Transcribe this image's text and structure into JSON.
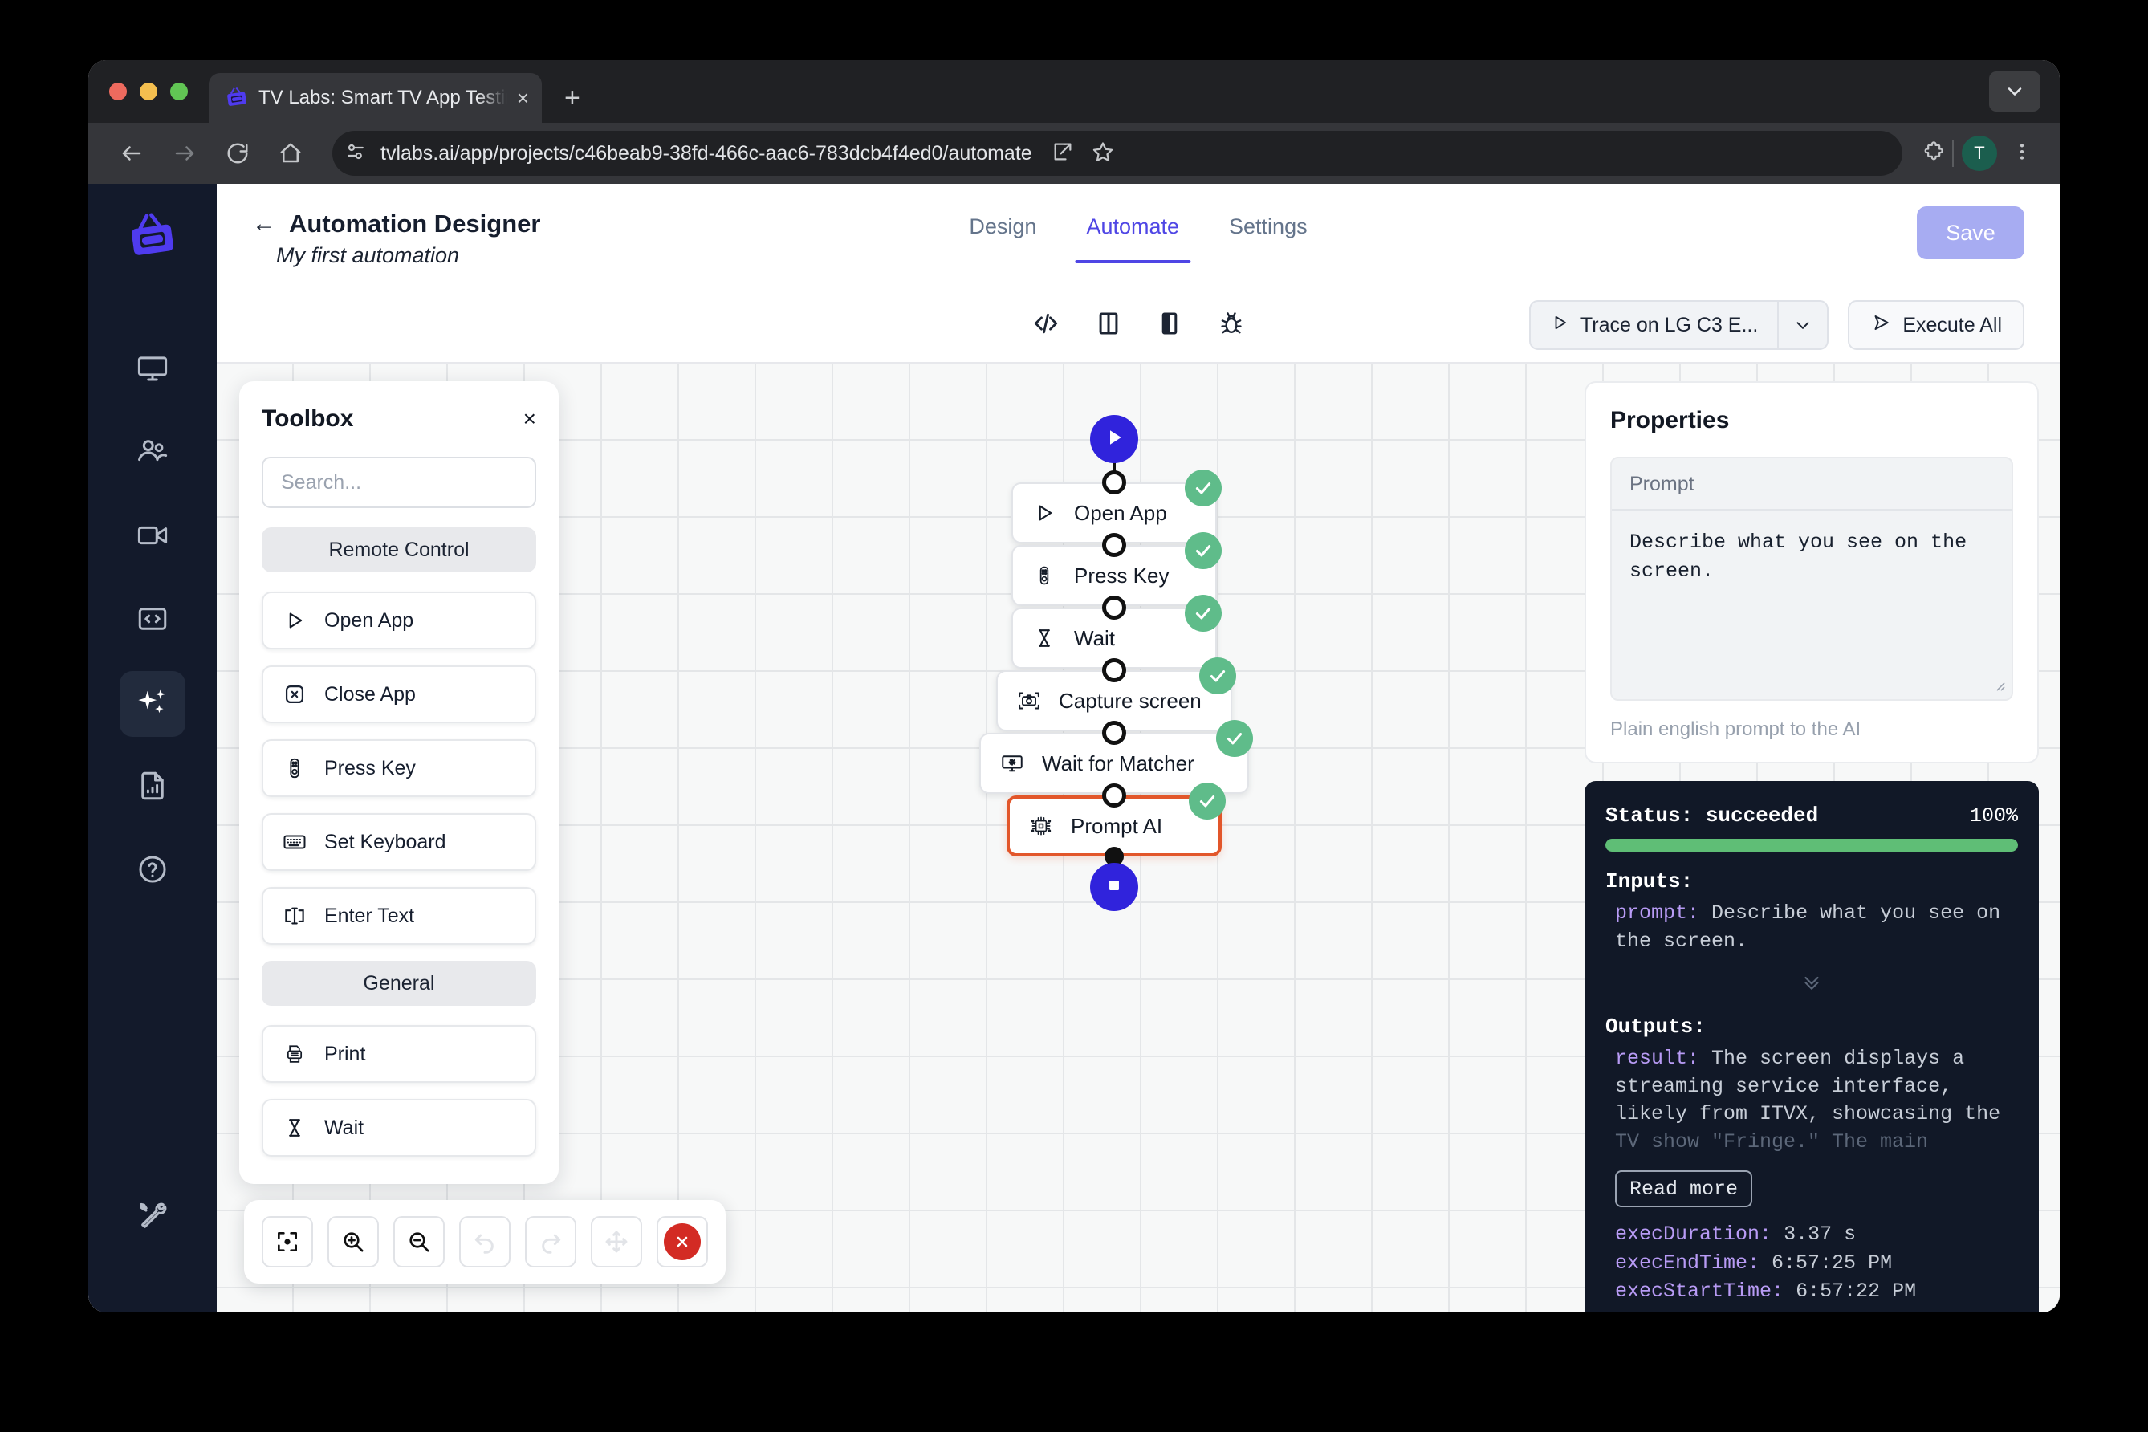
{
  "browser": {
    "tab_title": "TV Labs: Smart TV App Testin",
    "tab_close_glyph": "×",
    "new_tab_glyph": "+",
    "url": "tvlabs.ai/app/projects/c46beab9-38fd-466c-aac6-783dcb4f4ed0/automate",
    "profile_initial": "T"
  },
  "rail": {
    "items": [
      {
        "name": "devices-icon"
      },
      {
        "name": "users-icon"
      },
      {
        "name": "video-icon"
      },
      {
        "name": "code-icon"
      },
      {
        "name": "sparkles-icon"
      },
      {
        "name": "report-icon"
      },
      {
        "name": "help-icon"
      },
      {
        "name": "tools-icon"
      }
    ]
  },
  "header": {
    "back_arrow": "←",
    "title": "Automation Designer",
    "subtitle": "My first automation",
    "save_label": "Save",
    "tabs": [
      {
        "label": "Design",
        "active": false
      },
      {
        "label": "Automate",
        "active": true
      },
      {
        "label": "Settings",
        "active": false
      }
    ]
  },
  "toolbar": {
    "icons": [
      {
        "name": "code-view-icon"
      },
      {
        "name": "split-panel-icon"
      },
      {
        "name": "half-panel-icon"
      },
      {
        "name": "debug-bug-icon"
      }
    ],
    "trace_label": "Trace on LG C3 E...",
    "execute_all_label": "Execute All"
  },
  "toolbox": {
    "title": "Toolbox",
    "close_glyph": "×",
    "search_placeholder": "Search...",
    "search_value": "",
    "sections": [
      {
        "label": "Remote Control",
        "items": [
          {
            "label": "Open App",
            "icon": "play-icon"
          },
          {
            "label": "Close App",
            "icon": "close-app-icon"
          },
          {
            "label": "Press Key",
            "icon": "remote-icon"
          },
          {
            "label": "Set Keyboard",
            "icon": "keyboard-icon"
          },
          {
            "label": "Enter Text",
            "icon": "text-cursor-icon"
          }
        ]
      },
      {
        "label": "General",
        "items": [
          {
            "label": "Print",
            "icon": "printer-icon"
          },
          {
            "label": "Wait",
            "icon": "hourglass-icon"
          }
        ]
      }
    ]
  },
  "flow": {
    "start_node": {
      "icon": "play-icon"
    },
    "end_node": {
      "icon": "stop-icon"
    },
    "nodes": [
      {
        "label": "Open App",
        "icon": "play-icon",
        "status": "succeeded",
        "selected": false
      },
      {
        "label": "Press Key",
        "icon": "remote-icon",
        "status": "succeeded",
        "selected": false
      },
      {
        "label": "Wait",
        "icon": "hourglass-icon",
        "status": "succeeded",
        "selected": false
      },
      {
        "label": "Capture screen",
        "icon": "camera-icon",
        "status": "succeeded",
        "selected": false
      },
      {
        "label": "Wait for Matcher",
        "icon": "matcher-icon",
        "status": "succeeded",
        "selected": false
      },
      {
        "label": "Prompt AI",
        "icon": "chip-icon",
        "status": "succeeded",
        "selected": true
      }
    ]
  },
  "canvas_toolbar": {
    "buttons": [
      {
        "name": "fit-view-button",
        "enabled": true
      },
      {
        "name": "zoom-in-button",
        "enabled": true
      },
      {
        "name": "zoom-out-button",
        "enabled": true
      },
      {
        "name": "undo-button",
        "enabled": false
      },
      {
        "name": "redo-button",
        "enabled": false
      },
      {
        "name": "pan-button",
        "enabled": false
      },
      {
        "name": "delete-button",
        "enabled": true
      }
    ]
  },
  "properties": {
    "title": "Properties",
    "prompt_label": "Prompt",
    "prompt_value": "Describe what you see on the screen.",
    "prompt_hint": "Plain english prompt to the AI"
  },
  "status_panel": {
    "status_label": "Status: succeeded",
    "percent": "100%",
    "progress": 100,
    "inputs_title": "Inputs:",
    "input_key": "prompt:",
    "input_value": "Describe what you see on the screen.",
    "expand_chevron": "⌄",
    "outputs_title": "Outputs:",
    "result_key": "result:",
    "result_value_visible": "The screen displays a streaming service interface, likely from ITVX, showcasing the",
    "result_value_faded": "TV show \"Fringe.\" The main",
    "read_more_label": "Read more",
    "timings": [
      {
        "key": "execDuration:",
        "value": "3.37 s"
      },
      {
        "key": "execEndTime:",
        "value": "6:57:25 PM"
      },
      {
        "key": "execStartTime:",
        "value": "6:57:22 PM"
      }
    ]
  },
  "colors": {
    "accent": "#4F46E5",
    "brand": "#3023DC",
    "success": "#5FBC8A",
    "selected_border": "#E2562A",
    "danger": "#D32B24",
    "rail_bg": "#131A2B",
    "status_bg": "#111827"
  }
}
